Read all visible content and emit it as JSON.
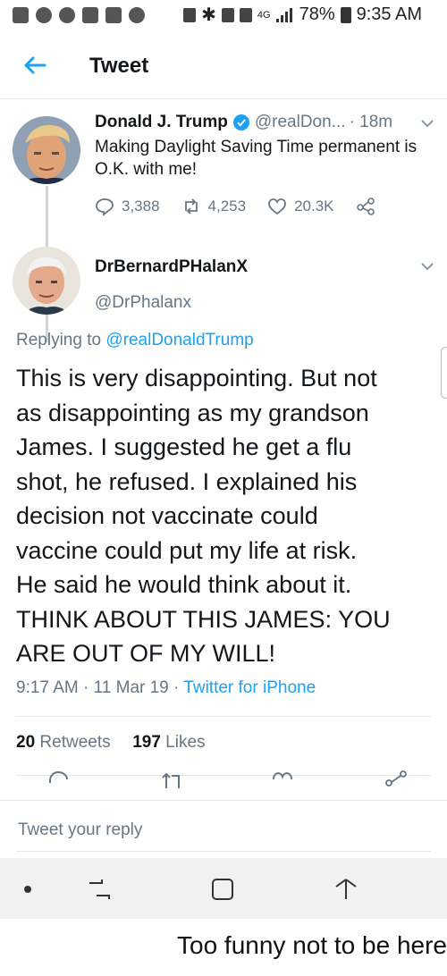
{
  "status_bar": {
    "battery": "78%",
    "time": "9:35 AM",
    "network": "4G"
  },
  "app_bar": {
    "title": "Tweet"
  },
  "original_tweet": {
    "author_name": "Donald J. Trump",
    "handle": "@realDon...",
    "age": "· 18m",
    "text": "Making Daylight Saving Time permanent is O.K. with me!",
    "replies": "3,388",
    "retweets": "4,253",
    "likes": "20.3K"
  },
  "reply_tweet": {
    "author_name": "DrBernardPHalanX",
    "handle": "@DrPhalanx",
    "replying_prefix": "Replying to",
    "replying_to": "@realDonaldTrump",
    "body_lines": [
      "This is very disappointing. But not",
      "as disappointing as my grandson",
      "James. I suggested he get a flu",
      "shot, he refused. I explained his",
      "decision not vaccinate could",
      "vaccine could put my life at risk.",
      "He said he would think about it.",
      "THINK ABOUT THIS JAMES: YOU",
      "ARE OUT OF MY WILL!"
    ],
    "time": "9:17 AM",
    "date": "11 Mar 19",
    "source": "Twitter for iPhone",
    "retweet_count": "20",
    "retweet_label": "Retweets",
    "like_count": "197",
    "like_label": "Likes"
  },
  "reply_box": {
    "placeholder": "Tweet your reply"
  },
  "caption": "Too funny not to be here",
  "colors": {
    "accent": "#1da1f2",
    "secondary_text": "#657786",
    "divider": "#e1e8ed"
  }
}
